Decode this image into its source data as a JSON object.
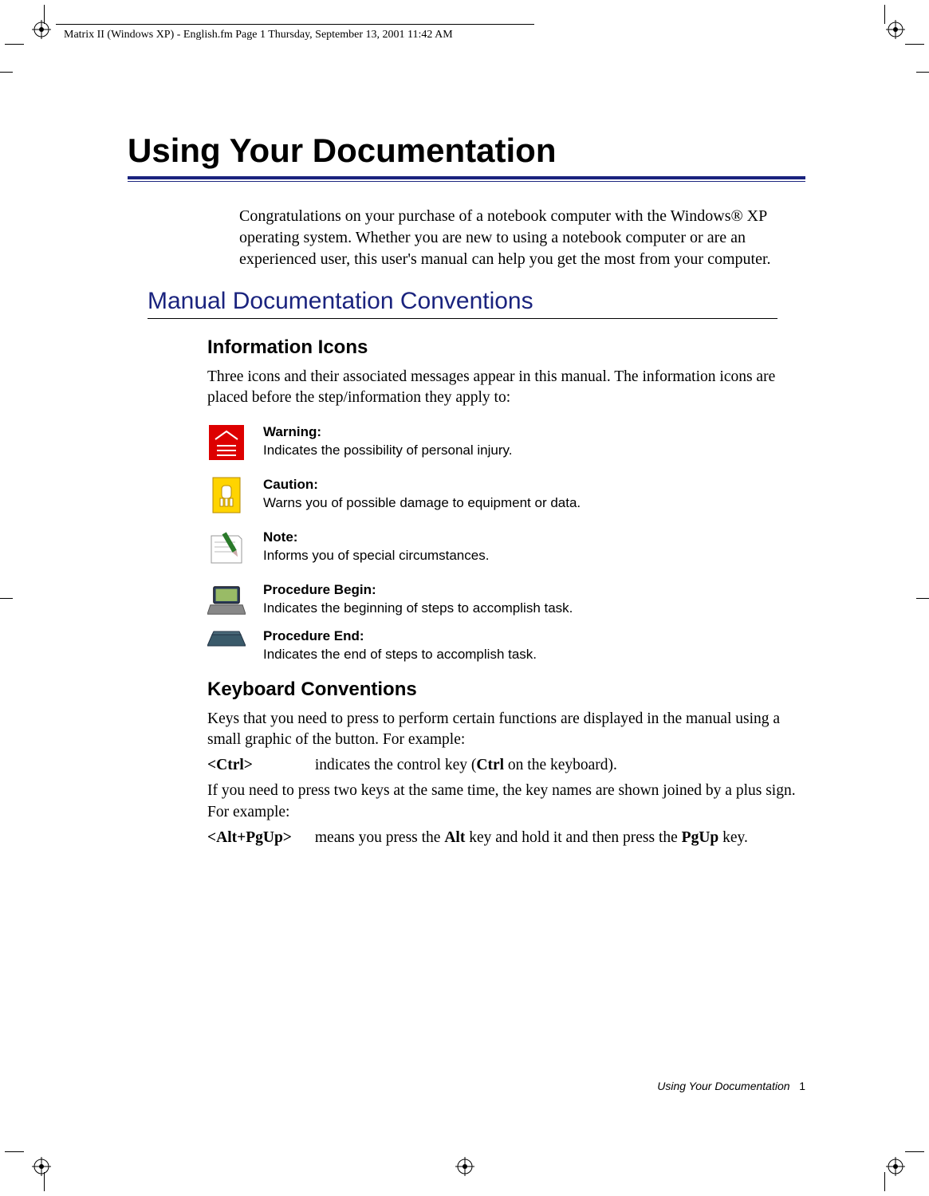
{
  "running_head": "Matrix II (Windows XP) - English.fm  Page 1  Thursday, September 13, 2001  11:42 AM",
  "title": "Using Your Documentation",
  "intro": "Congratulations on your purchase of a notebook computer with the Windows® XP operating system. Whether you are new to using a notebook computer or are an experienced user, this user's manual can help you get the most from your computer.",
  "h2": "Manual Documentation Conventions",
  "section1": {
    "heading": "Information Icons",
    "body": "Three icons and their associated messages appear in this manual. The information icons are placed before the step/information they apply to:"
  },
  "icons": [
    {
      "name": "warning",
      "label": "Warning:",
      "desc": "Indicates the possibility of personal injury."
    },
    {
      "name": "caution",
      "label": "Caution:",
      "desc": "Warns you of possible damage to equipment or data."
    },
    {
      "name": "note",
      "label": "Note:",
      "desc": "Informs you of special circumstances."
    },
    {
      "name": "procedure_begin",
      "label": "Procedure Begin:",
      "desc": "Indicates the beginning of steps to accomplish task."
    },
    {
      "name": "procedure_end",
      "label": "Procedure End:",
      "desc": "Indicates the end of steps to accomplish task."
    }
  ],
  "section2": {
    "heading": "Keyboard Conventions",
    "body1": "Keys that you need to press to perform certain functions are displayed in the manual using a small graphic of the button. For example:",
    "key1_name": "<Ctrl>",
    "key1_desc_a": "indicates the control key (",
    "key1_desc_b": "Ctrl",
    "key1_desc_c": " on the keyboard).",
    "body2": "If you need to press two keys at the same time, the key names are shown joined by a plus sign. For example:",
    "key2_name": "<Alt+PgUp>",
    "key2_desc_a": "means you press the ",
    "key2_desc_b": "Alt",
    "key2_desc_c": " key and hold it and then press the ",
    "key2_desc_d": "PgUp",
    "key2_desc_e": " key."
  },
  "footer_label": "Using Your Documentation",
  "footer_page": "1"
}
